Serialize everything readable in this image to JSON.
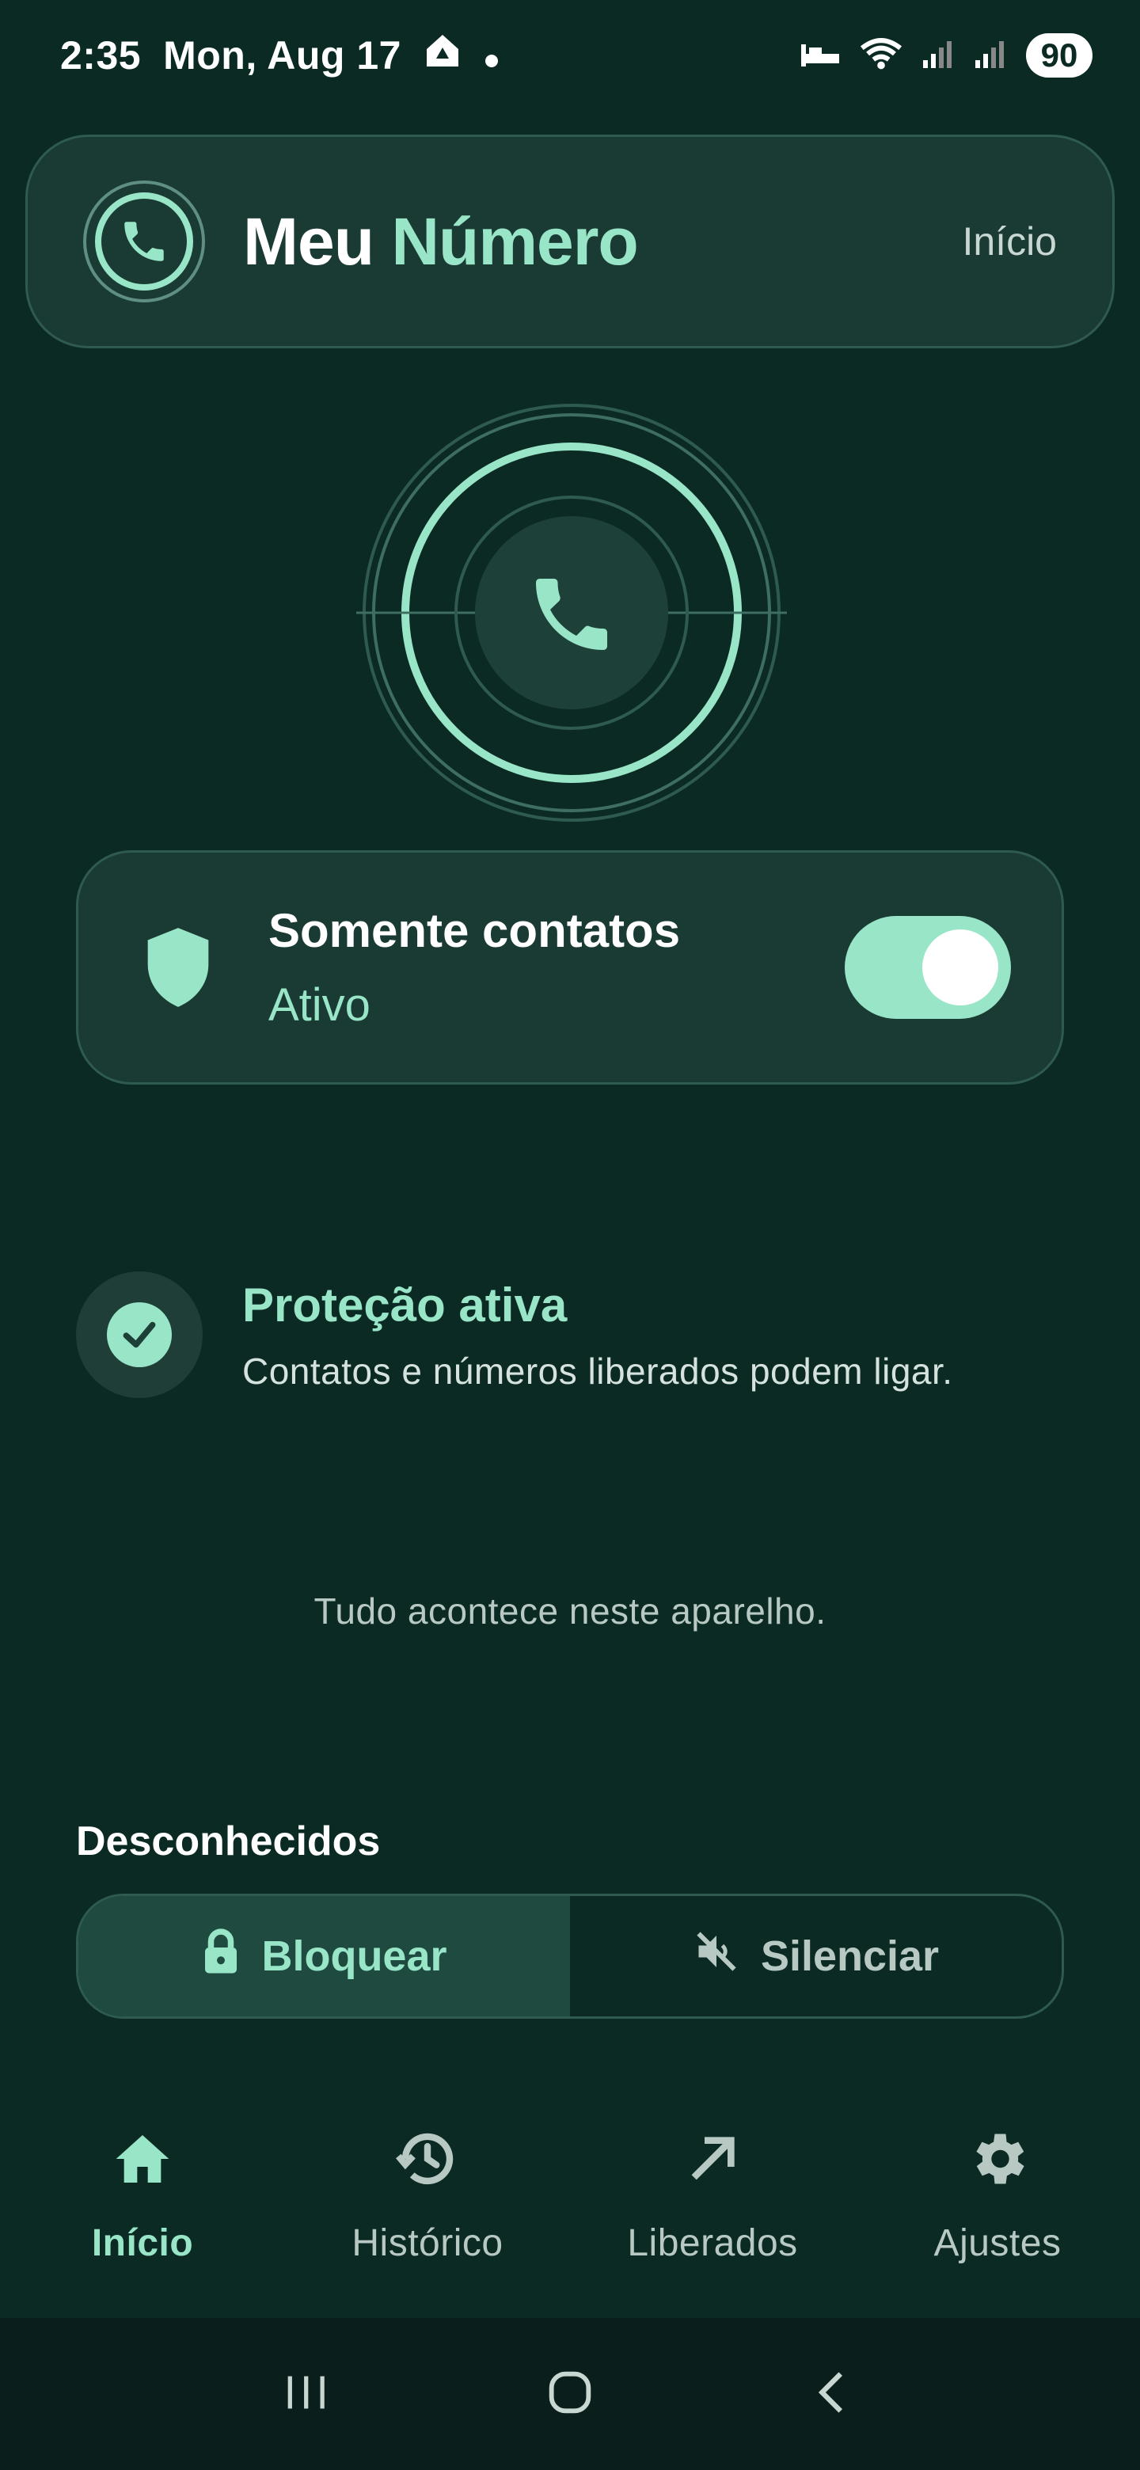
{
  "status_bar": {
    "time": "2:35",
    "date": "Mon, Aug 17",
    "battery": "90"
  },
  "header": {
    "title_part1": "Meu ",
    "title_part2": "Número",
    "link": "Início"
  },
  "filter_card": {
    "title": "Somente contatos",
    "status": "Ativo",
    "toggle_on": true
  },
  "protection": {
    "title": "Proteção ativa",
    "subtitle": "Contatos e números liberados podem ligar."
  },
  "note": "Tudo acontece neste aparelho.",
  "unknown": {
    "label": "Desconhecidos",
    "options": [
      {
        "label": "Bloquear",
        "icon": "lock-icon",
        "selected": true
      },
      {
        "label": "Silenciar",
        "icon": "volume-off-icon",
        "selected": false
      }
    ]
  },
  "bottom_nav": [
    {
      "label": "Início",
      "icon": "home-icon",
      "active": true
    },
    {
      "label": "Histórico",
      "icon": "history-icon",
      "active": false
    },
    {
      "label": "Liberados",
      "icon": "arrow-up-right-icon",
      "active": false
    },
    {
      "label": "Ajustes",
      "icon": "gear-icon",
      "active": false
    }
  ],
  "colors": {
    "background": "#0b2a24",
    "accent": "#98e6c7",
    "card": "#1a3a34"
  }
}
